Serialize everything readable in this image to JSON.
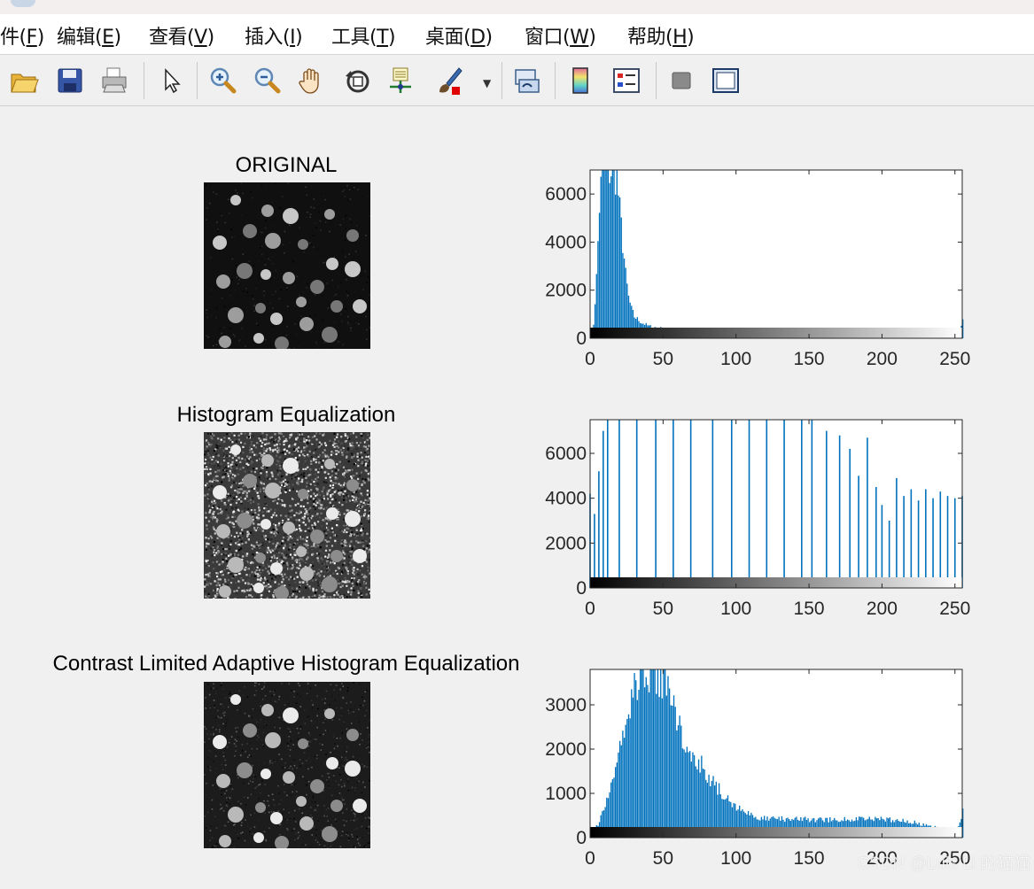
{
  "menubar": {
    "items": [
      {
        "pre": "件(",
        "key": "F",
        "post": ")"
      },
      {
        "pre": "编辑(",
        "key": "E",
        "post": ")"
      },
      {
        "pre": "查看(",
        "key": "V",
        "post": ")"
      },
      {
        "pre": "插入(",
        "key": "I",
        "post": ")"
      },
      {
        "pre": "工具(",
        "key": "T",
        "post": ")"
      },
      {
        "pre": "桌面(",
        "key": "D",
        "post": ")"
      },
      {
        "pre": "窗口(",
        "key": "W",
        "post": ")"
      },
      {
        "pre": "帮助(",
        "key": "H",
        "post": ")"
      }
    ]
  },
  "toolbar": {
    "icons": [
      "open-file-icon",
      "save-icon",
      "print-icon",
      "pointer-icon",
      "zoom-in-icon",
      "zoom-out-icon",
      "pan-hand-icon",
      "rotate-3d-icon",
      "data-cursor-icon",
      "brush-icon",
      "link-plot-icon",
      "colorbar-icon",
      "legend-icon",
      "hide-plot-tools-icon",
      "show-plot-tools-icon"
    ]
  },
  "panels": [
    {
      "title": "ORIGINAL"
    },
    {
      "title": "Histogram Equalization"
    },
    {
      "title": "Contrast Limited Adaptive Histogram Equalization"
    }
  ],
  "watermark": "CSDN @Luis Li 的猫猫",
  "chart_data": [
    {
      "type": "bar",
      "title": "",
      "xlim": [
        0,
        255
      ],
      "ylim": [
        0,
        7000
      ],
      "xticks": [
        0,
        50,
        100,
        150,
        200,
        250
      ],
      "yticks": [
        0,
        2000,
        4000,
        6000
      ],
      "bar_color": "#0072BD",
      "x": [
        0,
        2,
        4,
        6,
        8,
        10,
        12,
        14,
        16,
        18,
        20,
        22,
        24,
        26,
        28,
        30,
        35,
        40,
        50,
        60,
        70,
        80,
        100,
        120,
        140,
        150,
        170,
        190,
        210,
        230,
        250,
        255
      ],
      "values": [
        0,
        600,
        2500,
        5500,
        7000,
        7000,
        7000,
        7000,
        7000,
        6800,
        5200,
        4000,
        2600,
        1700,
        1200,
        900,
        650,
        500,
        400,
        340,
        300,
        300,
        320,
        360,
        380,
        340,
        260,
        150,
        80,
        40,
        20,
        700
      ]
    },
    {
      "type": "bar",
      "title": "",
      "xlim": [
        0,
        255
      ],
      "ylim": [
        0,
        7500
      ],
      "xticks": [
        0,
        50,
        100,
        150,
        200,
        250
      ],
      "yticks": [
        0,
        2000,
        4000,
        6000
      ],
      "bar_color": "#0072BD",
      "x": [
        0,
        3,
        6,
        9,
        12,
        20,
        32,
        45,
        57,
        69,
        84,
        97,
        109,
        121,
        133,
        145,
        152,
        162,
        171,
        178,
        184,
        190,
        196,
        200,
        205,
        210,
        215,
        220,
        225,
        230,
        235,
        240,
        245,
        250,
        255
      ],
      "values": [
        4200,
        3300,
        5200,
        7000,
        7500,
        7500,
        7500,
        7500,
        7500,
        7500,
        7500,
        7500,
        7500,
        7500,
        7500,
        7500,
        7500,
        7000,
        6800,
        6200,
        5000,
        6700,
        4500,
        3700,
        3000,
        4900,
        4100,
        4400,
        3900,
        4400,
        4000,
        4300,
        4100,
        4000,
        4100
      ]
    },
    {
      "type": "bar",
      "title": "",
      "xlim": [
        0,
        255
      ],
      "ylim": [
        0,
        3800
      ],
      "xticks": [
        0,
        50,
        100,
        150,
        200,
        250
      ],
      "yticks": [
        0,
        1000,
        2000,
        3000
      ],
      "bar_color": "#0072BD",
      "x": [
        0,
        5,
        10,
        15,
        20,
        25,
        30,
        35,
        40,
        45,
        50,
        55,
        60,
        65,
        70,
        75,
        80,
        90,
        100,
        110,
        120,
        140,
        160,
        180,
        200,
        220,
        235,
        245,
        250,
        255
      ],
      "values": [
        100,
        300,
        700,
        1300,
        2000,
        2800,
        3400,
        3700,
        3800,
        3800,
        3500,
        3000,
        2600,
        2200,
        1900,
        1700,
        1400,
        1000,
        700,
        500,
        420,
        420,
        400,
        420,
        420,
        350,
        250,
        120,
        50,
        600
      ]
    }
  ]
}
